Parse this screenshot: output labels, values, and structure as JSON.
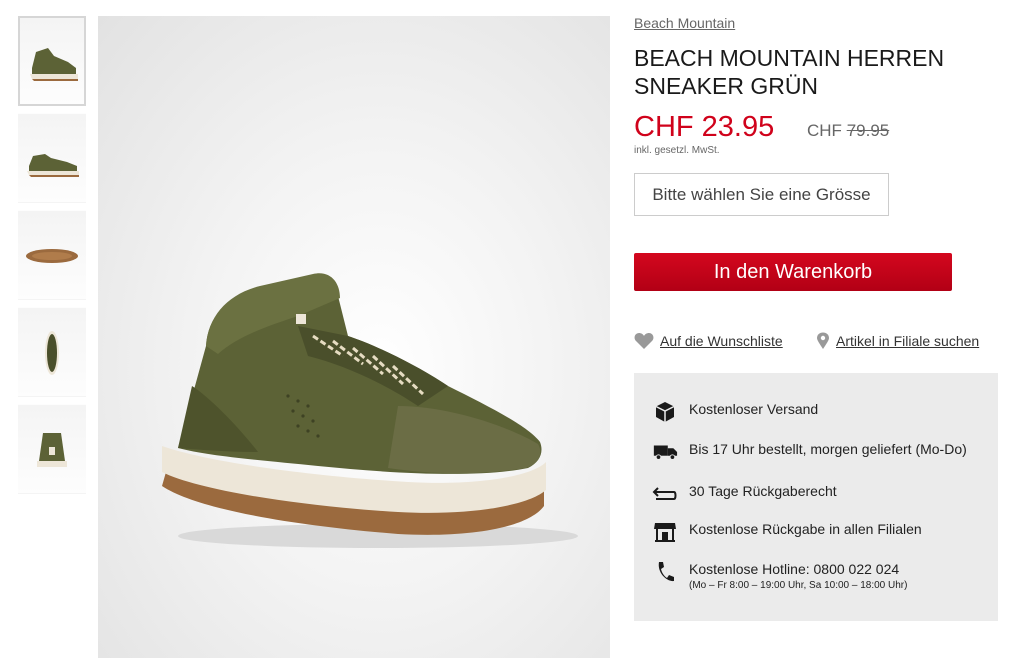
{
  "product": {
    "brand": "Beach Mountain",
    "title": "BEACH MOUNTAIN HERREN SNEAKER GRÜN",
    "price": "CHF 23.95",
    "old_price_currency": "CHF",
    "old_price_value": "79.95",
    "tax_note": "inkl. gesetzl. MwSt."
  },
  "size_select": {
    "placeholder": "Bitte wählen Sie eine Grösse"
  },
  "cart_button": {
    "label": "In den Warenkorb"
  },
  "links": {
    "wishlist": "Auf die Wunschliste",
    "store_search": "Artikel in Filiale suchen"
  },
  "benefits": [
    {
      "icon": "package-icon",
      "text": "Kostenloser Versand"
    },
    {
      "icon": "truck-icon",
      "text": "Bis 17 Uhr bestellt, morgen geliefert (Mo-Do)"
    },
    {
      "icon": "return-arrow-icon",
      "text": "30 Tage Rückgaberecht"
    },
    {
      "icon": "store-icon",
      "text": "Kostenlose Rückgabe in allen Filialen"
    },
    {
      "icon": "phone-icon",
      "text": "Kostenlose Hotline: 0800 022 024",
      "sub": "(Mo – Fr 8:00 – 19:00 Uhr, Sa 10:00 – 18:00 Uhr)"
    }
  ],
  "colors": {
    "accent": "#d0021b",
    "shoe": "#5c6236",
    "sole": "#ede6d8",
    "outsole": "#9b6a3e"
  },
  "thumbnails": [
    {
      "view": "side-angle",
      "active": true
    },
    {
      "view": "side"
    },
    {
      "view": "sole"
    },
    {
      "view": "top"
    },
    {
      "view": "back"
    }
  ]
}
